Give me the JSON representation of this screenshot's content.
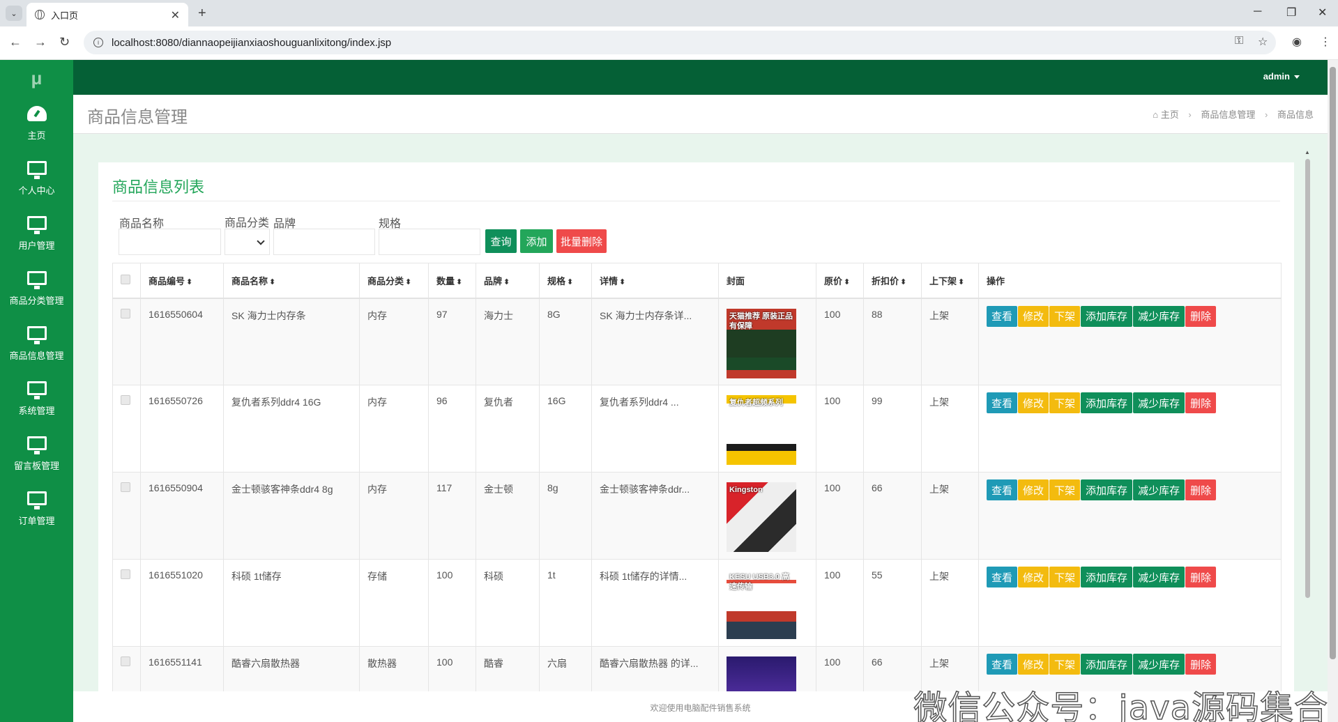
{
  "browser": {
    "tab_title": "入口页",
    "url": "localhost:8080/diannaopeijianxiaoshouguanlixitong/index.jsp"
  },
  "sidebar": {
    "logo": "μ",
    "items": [
      {
        "label": "主页",
        "icon": "dashboard-icon"
      },
      {
        "label": "个人中心",
        "icon": "monitor-icon"
      },
      {
        "label": "用户管理",
        "icon": "monitor-icon"
      },
      {
        "label": "商品分类管理",
        "icon": "monitor-icon"
      },
      {
        "label": "商品信息管理",
        "icon": "monitor-icon"
      },
      {
        "label": "系统管理",
        "icon": "monitor-icon"
      },
      {
        "label": "留言板管理",
        "icon": "monitor-icon"
      },
      {
        "label": "订单管理",
        "icon": "monitor-icon"
      }
    ]
  },
  "header": {
    "user": "admin"
  },
  "page": {
    "title": "商品信息管理",
    "breadcrumb": [
      "主页",
      "商品信息管理",
      "商品信息"
    ]
  },
  "panel": {
    "title": "商品信息列表",
    "search": {
      "name_label": "商品名称",
      "category_label": "商品分类",
      "brand_label": "品牌",
      "spec_label": "规格"
    },
    "buttons": {
      "query": "查询",
      "add": "添加",
      "batch_delete": "批量删除"
    }
  },
  "table": {
    "headers": [
      "商品编号",
      "商品名称",
      "商品分类",
      "数量",
      "品牌",
      "规格",
      "详情",
      "封面",
      "原价",
      "折扣价",
      "上下架",
      "操作"
    ],
    "rows": [
      {
        "id": "1616550604",
        "name": "SK 海力士内存条",
        "category": "内存",
        "qty": "97",
        "brand": "海力士",
        "spec": "8G",
        "detail": "SK 海力士内存条详...",
        "price": "100",
        "discount": "88",
        "status": "上架",
        "cover_text": "天猫推荐 原装正品有保障"
      },
      {
        "id": "1616550726",
        "name": "复仇者系列ddr4 16G",
        "category": "内存",
        "qty": "96",
        "brand": "复仇者",
        "spec": "16G",
        "detail": "复仇者系列ddr4 ...",
        "price": "100",
        "discount": "99",
        "status": "上架",
        "cover_text": "复仇者超频系列"
      },
      {
        "id": "1616550904",
        "name": "金士顿骇客神条ddr4 8g",
        "category": "内存",
        "qty": "117",
        "brand": "金士顿",
        "spec": "8g",
        "detail": "金士顿骇客神条ddr...",
        "price": "100",
        "discount": "66",
        "status": "上架",
        "cover_text": "Kingston"
      },
      {
        "id": "1616551020",
        "name": "科硕 1t储存",
        "category": "存储",
        "qty": "100",
        "brand": "科硕",
        "spec": "1t",
        "detail": "科硕 1t储存的详情...",
        "price": "100",
        "discount": "55",
        "status": "上架",
        "cover_text": "KESU USB3.0 高速传输"
      },
      {
        "id": "1616551141",
        "name": "酷睿六扇散热器",
        "category": "散热器",
        "qty": "100",
        "brand": "酷睿",
        "spec": "六扇",
        "detail": "酷睿六扇散热器 的详...",
        "price": "100",
        "discount": "66",
        "status": "上架",
        "cover_text": ""
      }
    ],
    "ops": [
      "查看",
      "修改",
      "下架",
      "添加库存",
      "减少库存",
      "删除"
    ]
  },
  "footer": "欢迎使用电脑配件销售系统",
  "watermark": "微信公众号：java源码集合",
  "colors": {
    "sidebar": "#0f8f46",
    "header": "#056036",
    "view": "#1f9ab6",
    "edit": "#f3bb0f",
    "stock": "#0f8f5a",
    "delete": "#ef4a4a"
  }
}
